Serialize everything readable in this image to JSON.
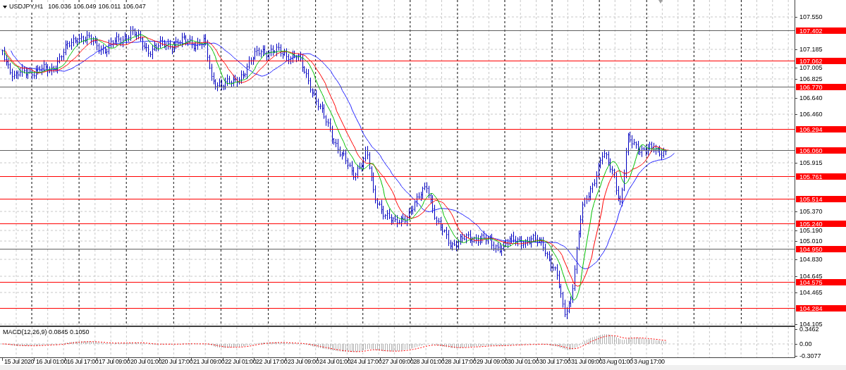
{
  "chart": {
    "symbol": "USDJPY,H1",
    "quote": [
      "106.036",
      "106.049",
      "106.011",
      "106.047"
    ]
  },
  "price_axis": {
    "ticks": [
      "107.550",
      "107.185",
      "107.005",
      "106.825",
      "106.640",
      "106.460",
      "105.915",
      "105.370",
      "105.190",
      "105.010",
      "104.830",
      "104.645",
      "104.465",
      "104.105"
    ]
  },
  "levels": [
    {
      "price": "107.402",
      "color": "#606060"
    },
    {
      "price": "107.062",
      "color": "#ff0000"
    },
    {
      "price": "106.770",
      "color": "#606060"
    },
    {
      "price": "106.294",
      "color": "#ff0000"
    },
    {
      "price": "106.060",
      "color": "#606060"
    },
    {
      "price": "105.761",
      "color": "#ff0000"
    },
    {
      "price": "105.514",
      "color": "#ff0000"
    },
    {
      "price": "105.240",
      "color": "#ff0000"
    },
    {
      "price": "104.950",
      "color": "#606060"
    },
    {
      "price": "104.575",
      "color": "#ff0000"
    },
    {
      "price": "104.284",
      "color": "#ff0000"
    }
  ],
  "indicator": {
    "label": "MACD(12,26,9) 0.0845 0.1050",
    "ticks": [
      "0.3462",
      "0.00",
      "-0.3077"
    ]
  },
  "time_axis": {
    "labels": [
      "15 Jul 2020",
      "16 Jul 01:00",
      "16 Jul 17:00",
      "17 Jul 09:00",
      "20 Jul 01:00",
      "20 Jul 17:00",
      "21 Jul 09:00",
      "22 Jul 01:00",
      "22 Jul 17:00",
      "23 Jul 09:00",
      "24 Jul 01:00",
      "24 Jul 17:00",
      "27 Jul 09:00",
      "28 Jul 01:00",
      "28 Jul 17:00",
      "29 Jul 09:00",
      "30 Jul 01:00",
      "30 Jul 17:00",
      "31 Jul 09:00",
      "3 Aug 01:00",
      "3 Aug 17:00"
    ]
  }
}
